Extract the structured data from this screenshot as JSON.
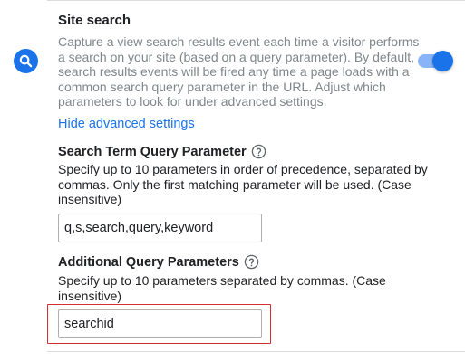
{
  "site_search": {
    "title": "Site search",
    "icon": "search-icon",
    "description": "Capture a view search results event each time a visitor performs a search on your site (based on a query parameter). By default, search results events will be fired any time a page loads with a common search query parameter in the URL. Adjust which parameters to look for under advanced settings.",
    "toggle_state": "on",
    "advanced_link": "Hide advanced settings"
  },
  "search_term": {
    "heading": "Search Term Query Parameter",
    "help_icon": "help-circle-icon",
    "description": "Specify up to 10 parameters in order of precedence, separated by commas. Only the first matching parameter will be used. (Case insensitive)",
    "value": "q,s,search,query,keyword"
  },
  "additional": {
    "heading": "Additional Query Parameters",
    "help_icon": "help-circle-icon",
    "description": "Specify up to 10 parameters separated by commas. (Case insensitive)",
    "value": "searchid"
  },
  "colors": {
    "accent": "#1a73e8",
    "highlight": "#d32f2f"
  }
}
